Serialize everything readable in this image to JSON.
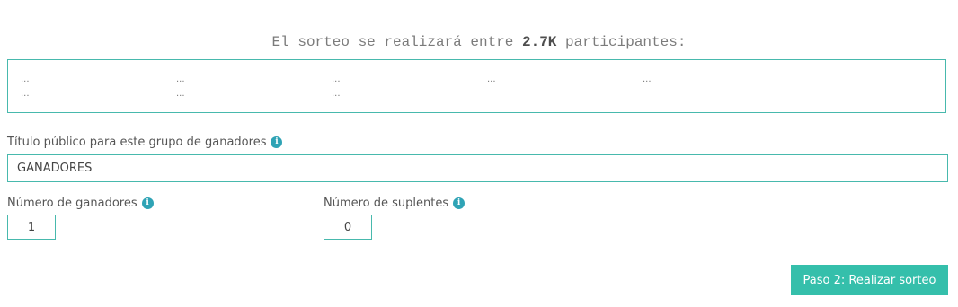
{
  "headline": {
    "prefix": "El sorteo se realizará entre",
    "count": "2.7K",
    "suffix": "participantes:"
  },
  "participants": {
    "row1": [
      "...",
      "...",
      "...",
      "...",
      "..."
    ],
    "row2": [
      "...",
      "...",
      "..."
    ]
  },
  "title_field": {
    "label": "Título público para este grupo de ganadores",
    "value": "GANADORES",
    "info_icon": "info-icon"
  },
  "winners_field": {
    "label": "Número de ganadores",
    "value": "1"
  },
  "substitutes_field": {
    "label": "Número de suplentes",
    "value": "0"
  },
  "submit_button": {
    "label": "Paso 2: Realizar sorteo"
  },
  "colors": {
    "accent": "#35bfab",
    "border": "#48b9ad",
    "info_icon": "#2fa3b5"
  }
}
